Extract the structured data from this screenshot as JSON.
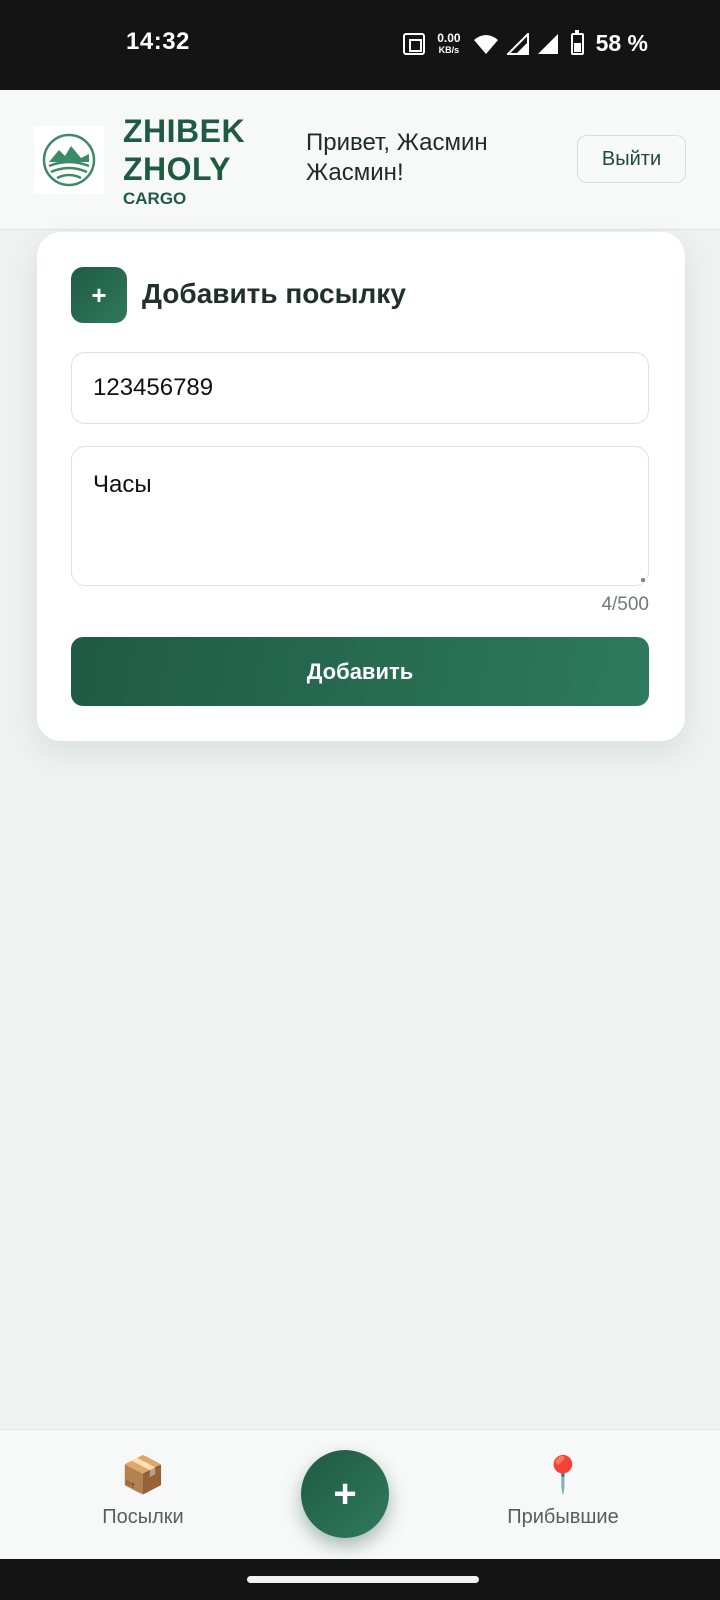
{
  "status_bar": {
    "time": "14:32",
    "net_speed_value": "0.00",
    "net_speed_unit": "KB/s",
    "battery_percent": "58 %",
    "icons": [
      "nfc-icon",
      "wifi-icon",
      "signal-icon",
      "signal-icon",
      "battery-icon"
    ]
  },
  "header": {
    "brand_line1": "ZHIBEK",
    "brand_line2": "ZHOLY",
    "brand_sub": "CARGO",
    "greeting_line1": "Привет, Жасмин",
    "greeting_line2": "Жасмин!",
    "logout_label": "Выйти"
  },
  "add_parcel": {
    "icon_glyph": "+",
    "title": "Добавить посылку",
    "tracking_value": "123456789",
    "description_value": "Часы",
    "char_counter": "4/500",
    "submit_label": "Добавить"
  },
  "bottom_nav": {
    "parcels_emoji": "📦",
    "parcels_label": "Посылки",
    "fab_glyph": "+",
    "arrived_emoji": "📍",
    "arrived_label": "Прибывшие"
  },
  "colors": {
    "brand_green": "#1f5a44",
    "accent_green": "#2e7a5c",
    "background": "#eef2f1",
    "status_bar": "#141414"
  }
}
